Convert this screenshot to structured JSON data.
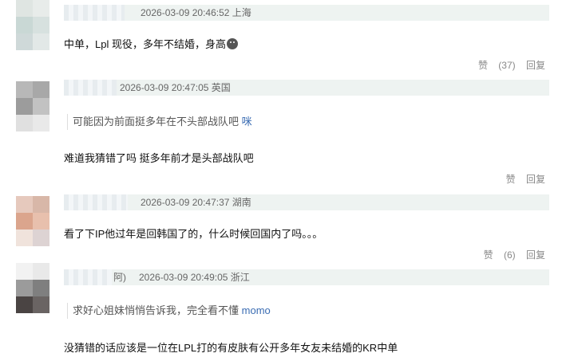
{
  "comments": [
    {
      "name_tail": "",
      "timestamp": "2026-03-09 20:46:52",
      "location": "上海",
      "text": "中单，Lpl 现役，多年不结婚，身高",
      "emoji": "sad-face-emoji",
      "like_label": "赞",
      "like_count": "(37)",
      "reply_label": "回复"
    },
    {
      "name_tail": "",
      "timestamp": "2026-03-09 20:47:05",
      "location": "英国",
      "quote_text": "可能因为前面挺多年在不头部战队吧",
      "quote_author": "咪",
      "text": "难道我猜错了吗 挺多年前才是头部战队吧",
      "like_label": "赞",
      "like_count": "",
      "reply_label": "回复"
    },
    {
      "name_tail": "",
      "timestamp": "2026-03-09 20:47:37",
      "location": "湖南",
      "text": "看了下IP他过年是回韩国了的，什么时候回国内了吗。。。",
      "like_label": "赞",
      "like_count": "(6)",
      "reply_label": "回复"
    },
    {
      "name_tail": "阿)",
      "timestamp": "2026-03-09 20:49:05",
      "location": "浙江",
      "quote_text": "求好心姐妹悄悄告诉我，完全看不懂",
      "quote_author": "momo",
      "text": "没猜错的话应该是一位在LPL打的有皮肤有公开多年女友未结婚的KR中单"
    }
  ],
  "colors": {
    "meta_bar_bg": "#eef3f1",
    "link_blue": "#3b6db3"
  }
}
